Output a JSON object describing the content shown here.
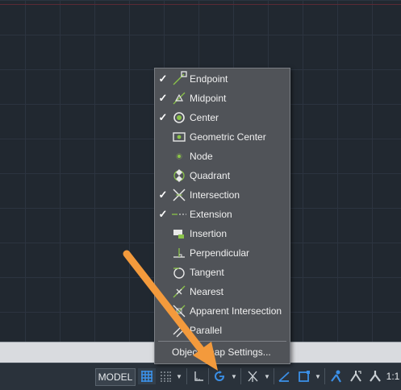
{
  "osnap_menu": {
    "items": [
      {
        "label": "Endpoint",
        "checked": true,
        "icon": "endpoint-icon"
      },
      {
        "label": "Midpoint",
        "checked": true,
        "icon": "midpoint-icon"
      },
      {
        "label": "Center",
        "checked": true,
        "icon": "center-icon"
      },
      {
        "label": "Geometric Center",
        "checked": false,
        "icon": "geometric-center-icon"
      },
      {
        "label": "Node",
        "checked": false,
        "icon": "node-icon"
      },
      {
        "label": "Quadrant",
        "checked": false,
        "icon": "quadrant-icon"
      },
      {
        "label": "Intersection",
        "checked": true,
        "icon": "intersection-icon"
      },
      {
        "label": "Extension",
        "checked": true,
        "icon": "extension-icon"
      },
      {
        "label": "Insertion",
        "checked": false,
        "icon": "insertion-icon"
      },
      {
        "label": "Perpendicular",
        "checked": false,
        "icon": "perpendicular-icon"
      },
      {
        "label": "Tangent",
        "checked": false,
        "icon": "tangent-icon"
      },
      {
        "label": "Nearest",
        "checked": false,
        "icon": "nearest-icon"
      },
      {
        "label": "Apparent Intersection",
        "checked": false,
        "icon": "apparent-intersection-icon"
      },
      {
        "label": "Parallel",
        "checked": false,
        "icon": "parallel-icon"
      }
    ],
    "check_mark": "✓",
    "settings_label": "Object Snap Settings..."
  },
  "statusbar": {
    "model_label": "MODEL",
    "scale_label": "1:1",
    "active_color": "#3b8fe6"
  }
}
